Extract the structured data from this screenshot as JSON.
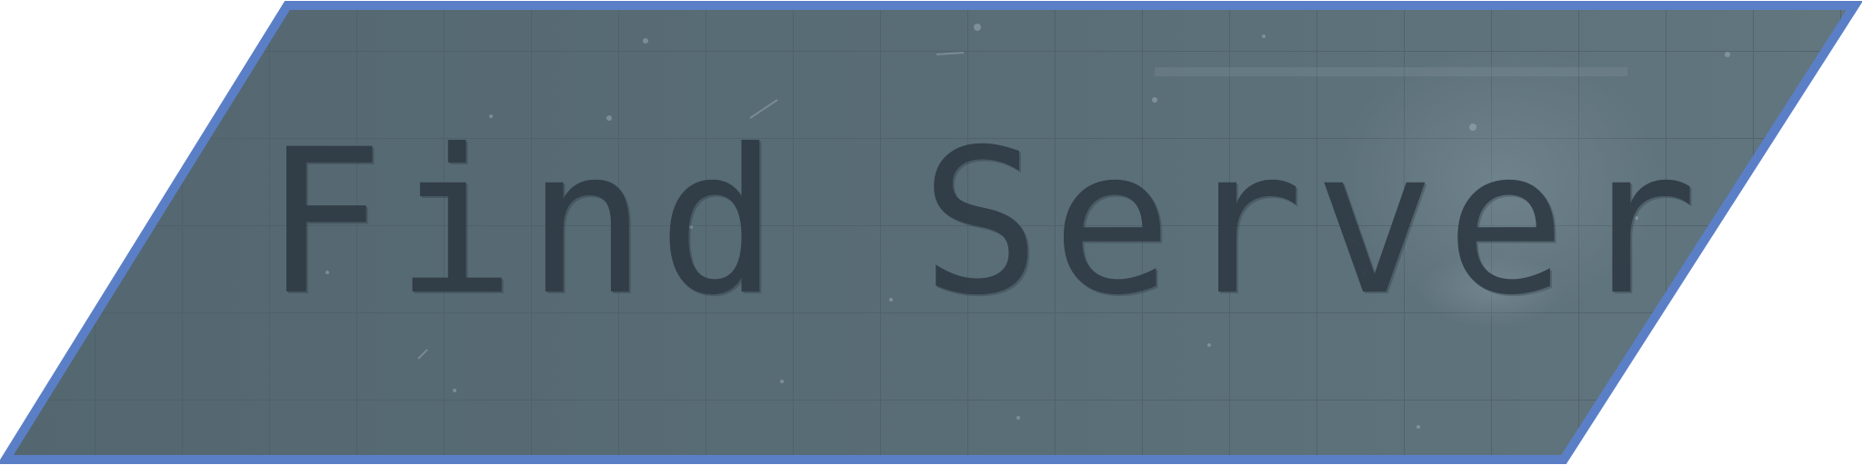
{
  "button": {
    "label": "Find Server",
    "border_color": "#5b7fc7",
    "fill_color": "#566a74",
    "text_color": "#2f3b44"
  }
}
